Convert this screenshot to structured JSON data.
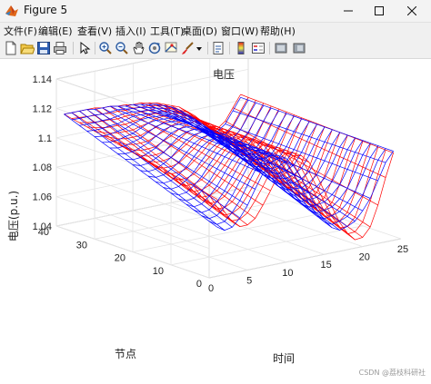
{
  "window": {
    "title": "Figure 5"
  },
  "menu": [
    "文件(F)",
    "编辑(E)",
    "查看(V)",
    "插入(I)",
    "工具(T)",
    "桌面(D)",
    "窗口(W)",
    "帮助(H)"
  ],
  "toolbar_icons": [
    "new-figure-icon",
    "open-file-icon",
    "save-icon",
    "print-icon",
    "select-arrow-icon",
    "zoom-in-icon",
    "zoom-out-icon",
    "pan-icon",
    "rotate-3d-icon",
    "data-cursor-icon",
    "brush-icon",
    "dropdown-arrow-icon",
    "link-plot-icon",
    "insert-colorbar-icon",
    "insert-legend-icon",
    "hide-plot-tools-icon",
    "show-plot-tools-icon"
  ],
  "chart_data": {
    "type": "mesh3d",
    "title": "电压",
    "xlabel": "时间",
    "ylabel": "节点",
    "zlabel": "电压(p.u.)",
    "xlim": [
      0,
      25
    ],
    "ylim": [
      0,
      40
    ],
    "zlim": [
      1.04,
      1.14
    ],
    "xticks": [
      "0",
      "5",
      "10",
      "15",
      "20",
      "25"
    ],
    "yticks": [
      "0",
      "10",
      "20",
      "30",
      "40"
    ],
    "zticks": [
      "1.04",
      "1.06",
      "1.08",
      "1.1",
      "1.12",
      "1.14"
    ],
    "grid": true,
    "surfaces": [
      {
        "name": "",
        "color": "#ff0000",
        "values_at_node_40": [
          1.115,
          1.115,
          1.115,
          1.115,
          1.115,
          1.114,
          1.114,
          1.113,
          1.113,
          1.112,
          1.112,
          1.111,
          1.11,
          1.108,
          1.106,
          1.104,
          1.1,
          1.096,
          1.09,
          1.086,
          1.084,
          1.088,
          1.096,
          1.104
        ]
      },
      {
        "name": "",
        "color": "#0000ff",
        "values_at_node_40": [
          1.115,
          1.115,
          1.115,
          1.115,
          1.114,
          1.114,
          1.114,
          1.113,
          1.112,
          1.112,
          1.111,
          1.11,
          1.109,
          1.107,
          1.105,
          1.102,
          1.098,
          1.094,
          1.088,
          1.084,
          1.082,
          1.086,
          1.094,
          1.102
        ]
      }
    ]
  },
  "watermark": "CSDN @荔枝科研社"
}
